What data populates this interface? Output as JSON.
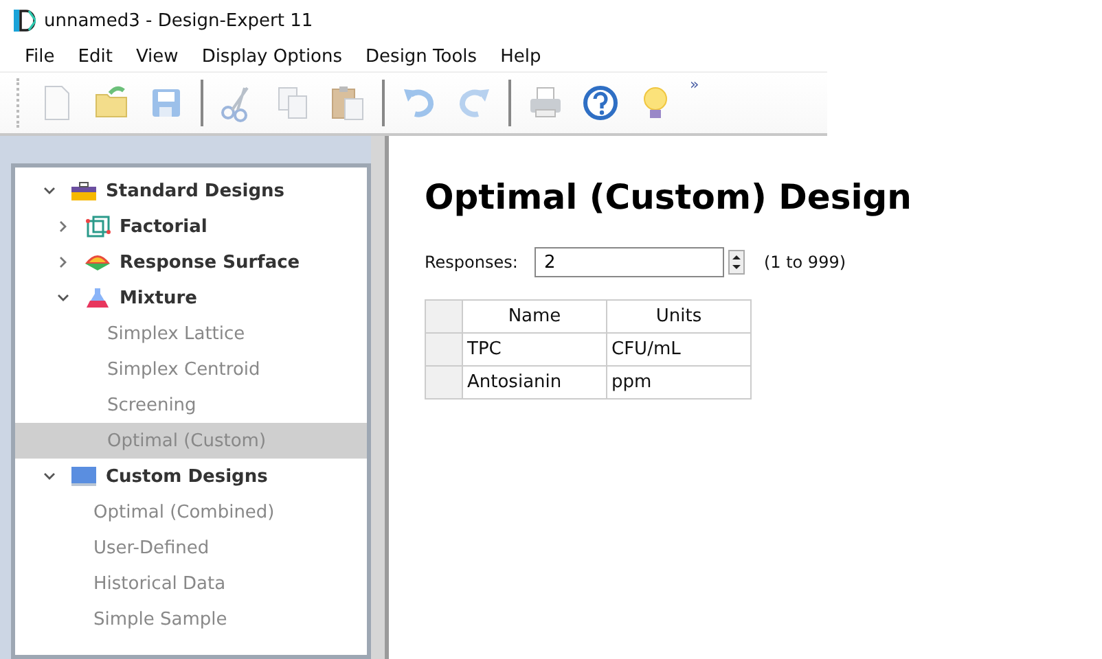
{
  "window": {
    "title": "unnamed3 - Design-Expert 11"
  },
  "menu": [
    "File",
    "Edit",
    "View",
    "Display Options",
    "Design Tools",
    "Help"
  ],
  "toolbar": [
    {
      "kind": "new"
    },
    {
      "kind": "open"
    },
    {
      "kind": "save"
    },
    {
      "kind": "sep"
    },
    {
      "kind": "cut"
    },
    {
      "kind": "copy"
    },
    {
      "kind": "paste"
    },
    {
      "kind": "sep"
    },
    {
      "kind": "undo"
    },
    {
      "kind": "redo"
    },
    {
      "kind": "sep"
    },
    {
      "kind": "print"
    },
    {
      "kind": "help"
    },
    {
      "kind": "tip"
    }
  ],
  "toolbar_overflow": "»",
  "tree": [
    {
      "label": "Standard Designs",
      "kind": "toolbox",
      "expanded": true,
      "children": [
        {
          "label": "Factorial",
          "kind": "cube",
          "expanded": false
        },
        {
          "label": "Response Surface",
          "kind": "surface",
          "expanded": false
        },
        {
          "label": "Mixture",
          "kind": "flask",
          "expanded": true,
          "children": [
            {
              "label": "Simplex Lattice",
              "selected": false
            },
            {
              "label": "Simplex Centroid",
              "selected": false
            },
            {
              "label": "Screening",
              "selected": false
            },
            {
              "label": "Optimal (Custom)",
              "selected": true
            }
          ]
        }
      ]
    },
    {
      "label": "Custom Designs",
      "kind": "monitor",
      "expanded": true,
      "children": [
        {
          "label": "Optimal (Combined)",
          "selected": false
        },
        {
          "label": "User-Defined",
          "selected": false
        },
        {
          "label": "Historical Data",
          "selected": false
        },
        {
          "label": "Simple Sample",
          "selected": false
        }
      ]
    }
  ],
  "heading": "Optimal (Custom) Design",
  "responses": {
    "label": "Responses:",
    "value": "2",
    "range": "(1 to 999)"
  },
  "table": {
    "columns": [
      "Name",
      "Units"
    ],
    "rows": [
      [
        "TPC",
        "CFU/mL"
      ],
      [
        "Antosianin",
        "ppm"
      ]
    ]
  }
}
